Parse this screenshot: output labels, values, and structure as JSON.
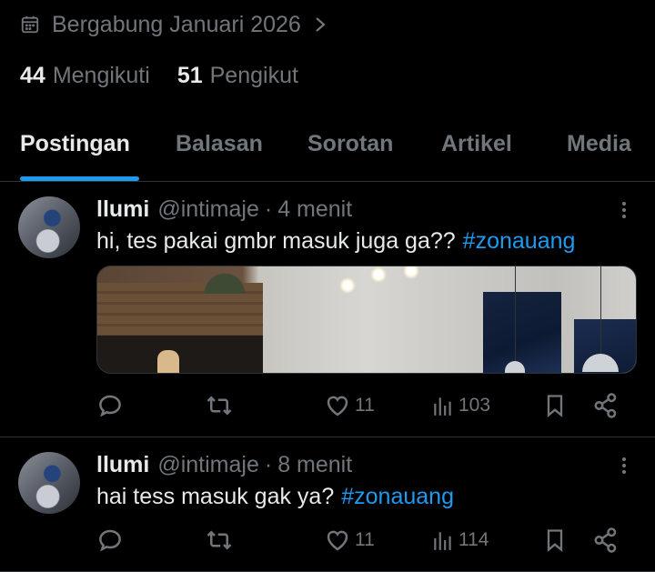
{
  "profile": {
    "joined": "Bergabung Januari 2026",
    "following_count": "44",
    "following_label": "Mengikuti",
    "followers_count": "51",
    "followers_label": "Pengikut"
  },
  "tabs": [
    {
      "label": "Postingan",
      "active": true
    },
    {
      "label": "Balasan"
    },
    {
      "label": "Sorotan"
    },
    {
      "label": "Artikel"
    },
    {
      "label": "Media"
    }
  ],
  "posts": [
    {
      "name": "llumi",
      "handle": "@intimaje",
      "sep": "·",
      "time": "4 menit",
      "text": "hi, tes pakai gmbr masuk juga ga??",
      "hashtag": "#zonauang",
      "has_image": true,
      "likes": "11",
      "views": "103"
    },
    {
      "name": "llumi",
      "handle": "@intimaje",
      "sep": "·",
      "time": "8 menit",
      "text": "hai tess masuk gak ya?",
      "hashtag": "#zonauang",
      "has_image": false,
      "likes": "11",
      "views": "114"
    }
  ],
  "colors": {
    "background": "#000000",
    "text": "#e7e9ea",
    "muted": "#71767b",
    "accent": "#1d9bf0",
    "divider": "#2f3336"
  },
  "icons": [
    "calendar-icon",
    "chevron-right-icon",
    "more-icon",
    "reply-icon",
    "retweet-icon",
    "like-icon",
    "views-icon",
    "bookmark-icon",
    "share-icon"
  ]
}
